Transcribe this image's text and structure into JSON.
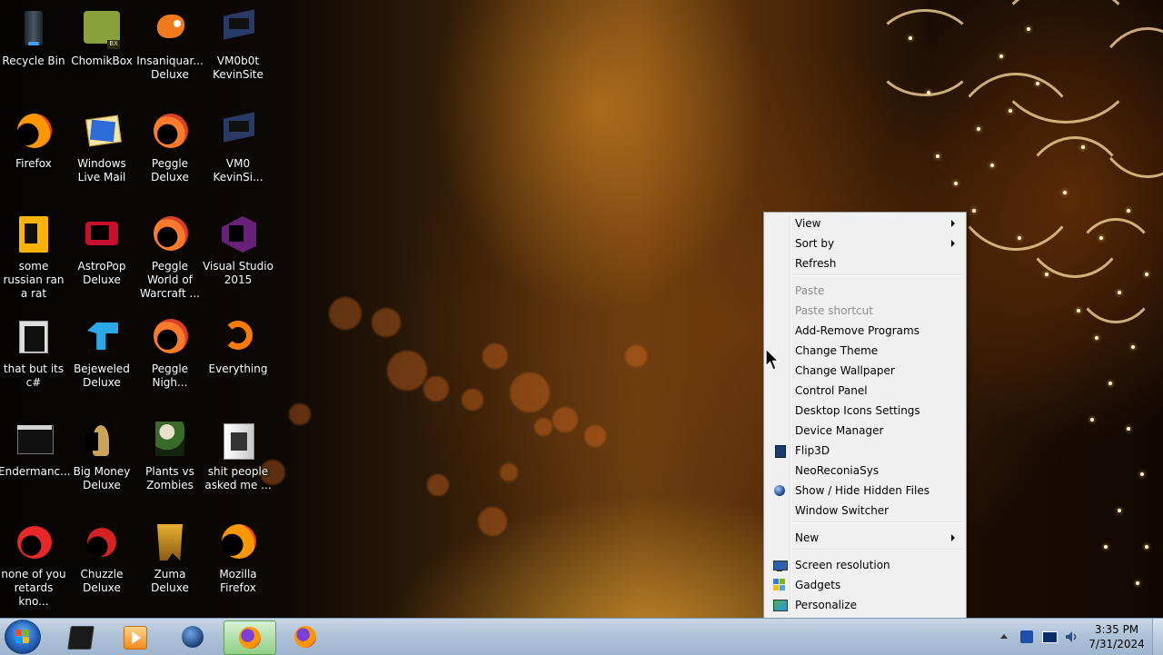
{
  "desktop": {
    "icons": [
      {
        "label": "Recycle Bin",
        "icon": "recycle-bin-icon"
      },
      {
        "label": "ChomikBox",
        "icon": "chomikbox-icon"
      },
      {
        "label": "Insaniquar... Deluxe",
        "icon": "insaniquarium-icon"
      },
      {
        "label": "VM0b0t KevinSite",
        "icon": "vm-shortcut-icon"
      },
      {
        "label": "Firefox",
        "icon": "firefox-icon"
      },
      {
        "label": "Windows Live Mail",
        "icon": "mail-icon"
      },
      {
        "label": "Peggle Deluxe",
        "icon": "peggle-icon"
      },
      {
        "label": "VM0 KevinSi...",
        "icon": "vm-shortcut-icon"
      },
      {
        "label": "some russian ran a rat",
        "icon": "document-icon"
      },
      {
        "label": "AstroPop Deluxe",
        "icon": "astropop-icon"
      },
      {
        "label": "Peggle World of Warcraft ...",
        "icon": "peggle-icon"
      },
      {
        "label": "Visual Studio 2015",
        "icon": "visual-studio-icon"
      },
      {
        "label": "that but its c#",
        "icon": "files-icon"
      },
      {
        "label": "Bejeweled Deluxe",
        "icon": "bejeweled-icon"
      },
      {
        "label": "Peggle Nigh...",
        "icon": "peggle-icon"
      },
      {
        "label": "Everything",
        "icon": "everything-search-icon"
      },
      {
        "label": "Endermanc...",
        "icon": "terminal-icon"
      },
      {
        "label": "Big Money Deluxe",
        "icon": "big-money-icon"
      },
      {
        "label": "Plants vs Zombies",
        "icon": "plants-vs-zombies-icon"
      },
      {
        "label": "shit people asked me ...",
        "icon": "folder-icon"
      },
      {
        "label": "none of you retards kno...",
        "icon": "game-icon"
      },
      {
        "label": "Chuzzle Deluxe",
        "icon": "chuzzle-icon"
      },
      {
        "label": "Zuma Deluxe",
        "icon": "zuma-icon"
      },
      {
        "label": "Mozilla Firefox",
        "icon": "firefox-icon"
      }
    ]
  },
  "context_menu": {
    "items": [
      {
        "label": "View",
        "submenu": true,
        "enabled": true,
        "icon": ""
      },
      {
        "label": "Sort by",
        "submenu": true,
        "enabled": true,
        "icon": ""
      },
      {
        "label": "Refresh",
        "submenu": false,
        "enabled": true,
        "icon": ""
      },
      {
        "label": "Paste",
        "submenu": false,
        "enabled": false,
        "icon": ""
      },
      {
        "label": "Paste shortcut",
        "submenu": false,
        "enabled": false,
        "icon": ""
      },
      {
        "label": "Add-Remove Programs",
        "submenu": false,
        "enabled": true,
        "icon": ""
      },
      {
        "label": "Change Theme",
        "submenu": false,
        "enabled": true,
        "icon": ""
      },
      {
        "label": "Change Wallpaper",
        "submenu": false,
        "enabled": true,
        "icon": ""
      },
      {
        "label": "Control Panel",
        "submenu": false,
        "enabled": true,
        "icon": ""
      },
      {
        "label": "Desktop Icons Settings",
        "submenu": false,
        "enabled": true,
        "icon": ""
      },
      {
        "label": "Device Manager",
        "submenu": false,
        "enabled": true,
        "icon": ""
      },
      {
        "label": "Flip3D",
        "submenu": false,
        "enabled": true,
        "icon": "flip3d-icon"
      },
      {
        "label": "NeoReconiaSys",
        "submenu": false,
        "enabled": true,
        "icon": ""
      },
      {
        "label": "Show / Hide Hidden Files",
        "submenu": false,
        "enabled": true,
        "icon": "globe-icon"
      },
      {
        "label": "Window Switcher",
        "submenu": false,
        "enabled": true,
        "icon": ""
      },
      {
        "label": "New",
        "submenu": true,
        "enabled": true,
        "icon": ""
      },
      {
        "label": "Screen resolution",
        "submenu": false,
        "enabled": true,
        "icon": "monitor-icon"
      },
      {
        "label": "Gadgets",
        "submenu": false,
        "enabled": true,
        "icon": "gadgets-icon"
      },
      {
        "label": "Personalize",
        "submenu": false,
        "enabled": true,
        "icon": "personalize-icon"
      }
    ]
  },
  "taskbar": {
    "buttons": [
      {
        "icon": "start-orb-icon"
      },
      {
        "icon": "terminal-app-icon"
      },
      {
        "icon": "media-player-icon"
      },
      {
        "icon": "globe-app-icon"
      },
      {
        "icon": "firefox-icon",
        "active": true
      },
      {
        "icon": "firefox-icon"
      }
    ],
    "tray_icons": [
      "show-hidden-icons-chevron",
      "network-app-icon",
      "display-icon",
      "volume-icon"
    ],
    "clock": {
      "time": "3:35 PM",
      "date": "7/31/2024"
    }
  }
}
